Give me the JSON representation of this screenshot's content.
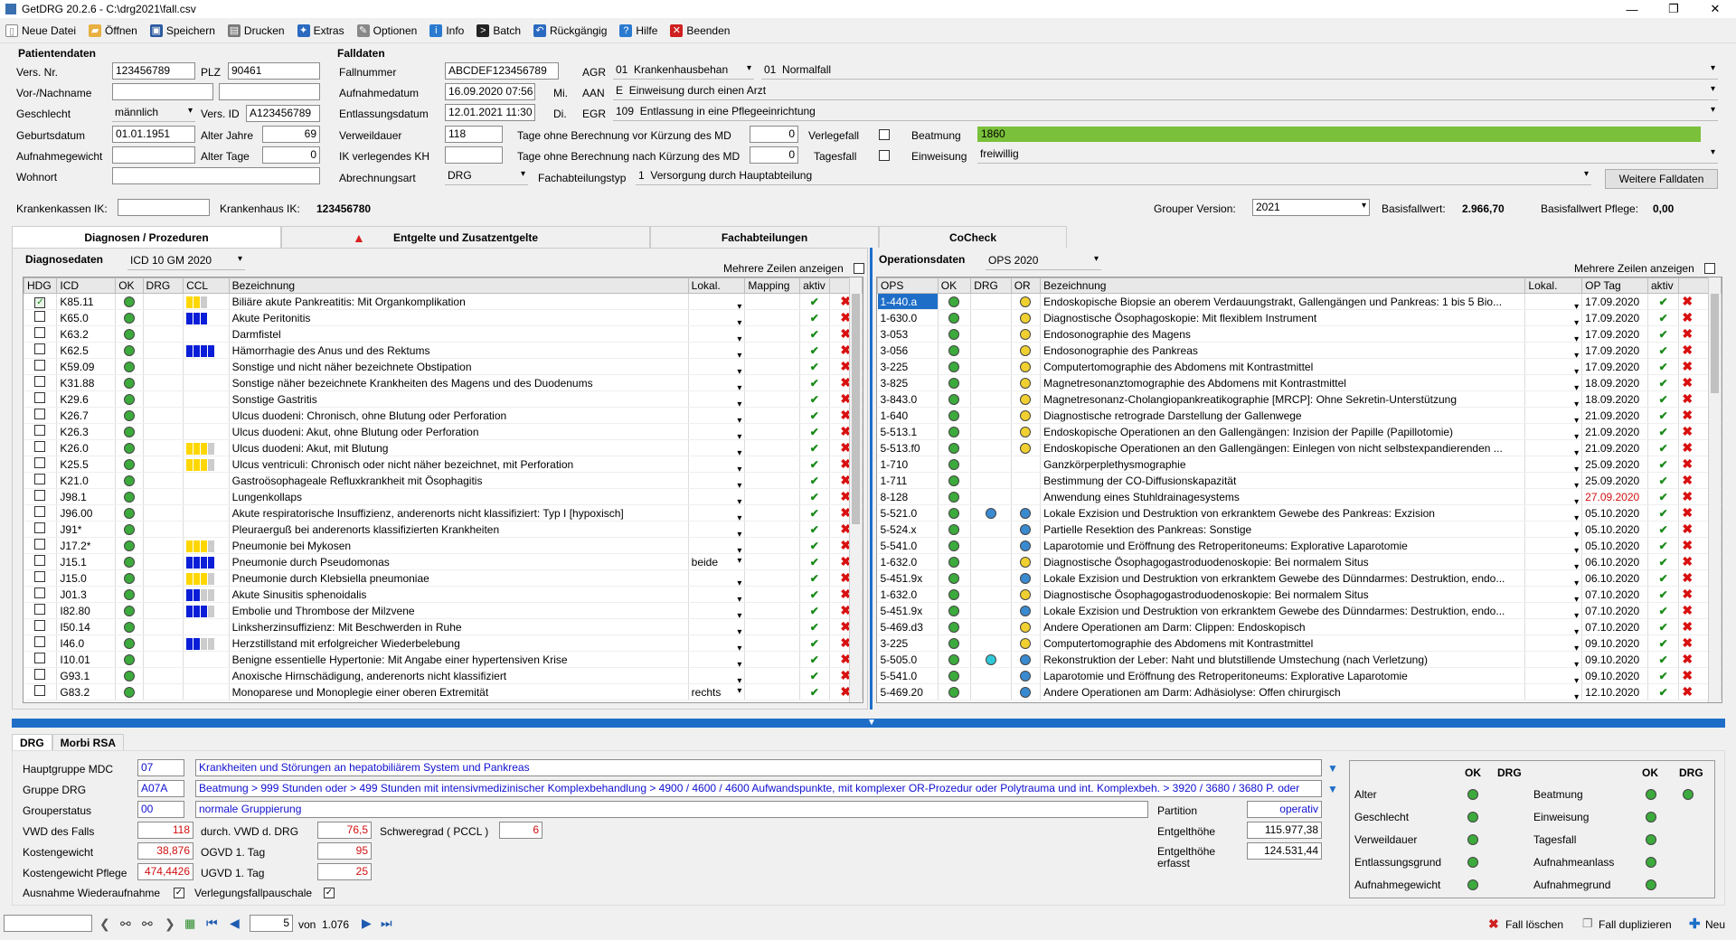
{
  "window": {
    "title": "GetDRG 20.2.6 - C:\\drg2021\\fall.csv"
  },
  "toolbar": [
    {
      "label": "Neue Datei",
      "icon": "new-file-icon",
      "color": "#ffffff"
    },
    {
      "label": "Öffnen",
      "icon": "folder-icon",
      "color": "#e8b040"
    },
    {
      "label": "Speichern",
      "icon": "save-icon",
      "color": "#2a5aa0"
    },
    {
      "label": "Drucken",
      "icon": "print-icon",
      "color": "#777777"
    },
    {
      "label": "Extras",
      "icon": "extras-icon",
      "color": "#2a6ac0"
    },
    {
      "label": "Optionen",
      "icon": "options-icon",
      "color": "#888888"
    },
    {
      "label": "Info",
      "icon": "info-icon",
      "color": "#2a7ad0"
    },
    {
      "label": "Batch",
      "icon": "batch-icon",
      "color": "#222222"
    },
    {
      "label": "Rückgängig",
      "icon": "undo-icon",
      "color": "#2a6ac0"
    },
    {
      "label": "Hilfe",
      "icon": "help-icon",
      "color": "#2a7ad0"
    },
    {
      "label": "Beenden",
      "icon": "exit-icon",
      "color": "#d02020"
    }
  ],
  "patient": {
    "title": "Patientendaten",
    "vers_nr_label": "Vers. Nr.",
    "vers_nr": "123456789",
    "plz_label": "PLZ",
    "plz": "90461",
    "name_label": "Vor-/Nachname",
    "vorname": "",
    "nachname": "",
    "geschlecht_label": "Geschlecht",
    "geschlecht": "männlich",
    "vers_id_label": "Vers. ID",
    "vers_id": "A123456789",
    "geburt_label": "Geburtsdatum",
    "geburt": "01.01.1951",
    "alter_jahre_label": "Alter Jahre",
    "alter_jahre": "69",
    "aufn_gew_label": "Aufnahmegewicht",
    "aufn_gew": "",
    "alter_tage_label": "Alter Tage",
    "alter_tage": "0",
    "wohnort_label": "Wohnort",
    "wohnort": ""
  },
  "fall": {
    "title": "Falldaten",
    "fallnummer_label": "Fallnummer",
    "fallnummer": "ABCDEF123456789",
    "agr_label": "AGR",
    "agr_code": "01",
    "agr_text": "Krankenhausbehan",
    "agr2_code": "01",
    "agr2_text": "Normalfall",
    "aufnahme_label": "Aufnahmedatum",
    "aufnahme": "16.09.2020 07:56",
    "aufnahme_day": "Mi.",
    "aan_label": "AAN",
    "aan_code": "E",
    "aan_text": "Einweisung durch einen Arzt",
    "entlassung_label": "Entlassungsdatum",
    "entlassung": "12.01.2021 11:30",
    "entlassung_day": "Di.",
    "egr_label": "EGR",
    "egr_code": "109",
    "egr_text": "Entlassung in eine Pflegeeinrichtung",
    "verweildauer_label": "Verweildauer",
    "verweildauer": "118",
    "tage_vor_label": "Tage ohne Berechnung vor Kürzung des MD",
    "tage_vor": "0",
    "verlegefall_label": "Verlegefall",
    "beatmung_label": "Beatmung",
    "beatmung": "1860",
    "ik_label": "IK verlegendes KH",
    "ik": "",
    "tage_nach_label": "Tage ohne Berechnung nach Kürzung des MD",
    "tage_nach": "0",
    "tagesfall_label": "Tagesfall",
    "einweisung_label": "Einweisung",
    "einweisung": "freiwillig",
    "abrechnung_label": "Abrechnungsart",
    "abrechnung": "DRG",
    "fachabt_label": "Fachabteilungstyp",
    "fachabt_code": "1",
    "fachabt_text": "Versorgung durch Hauptabteilung",
    "weitere_button": "Weitere Falldaten"
  },
  "ik_row": {
    "kk_label": "Krankenkassen IK:",
    "kk": "",
    "kh_label": "Krankenhaus IK:",
    "kh": "123456780",
    "grouper_label": "Grouper Version:",
    "grouper": "2021",
    "basis_label": "Basisfallwert:",
    "basis": "2.966,70",
    "basis_pflege_label": "Basisfallwert Pflege:",
    "basis_pflege": "0,00"
  },
  "tabs": [
    "Diagnosen / Prozeduren",
    "Entgelte und Zusatzentgelte",
    "Fachabteilungen",
    "CoCheck"
  ],
  "diag": {
    "title": "Diagnosedaten",
    "catalog": "ICD 10 GM 2020",
    "mehrere": "Mehrere Zeilen anzeigen",
    "headers": [
      "HDG",
      "ICD",
      "OK",
      "DRG",
      "CCL",
      "Bezeichnung",
      "Lokal.",
      "Mapping",
      "aktiv",
      ""
    ],
    "rows": [
      {
        "hdg": true,
        "icd": "K85.11",
        "ccl": "yyg",
        "text": "Biliäre akute Pankreatitis: Mit Organkomplikation",
        "lokal": ""
      },
      {
        "hdg": false,
        "icd": "K65.0",
        "ccl": "bbb",
        "text": "Akute Peritonitis",
        "lokal": ""
      },
      {
        "hdg": false,
        "icd": "K63.2",
        "ccl": "",
        "text": "Darmfistel",
        "lokal": ""
      },
      {
        "hdg": false,
        "icd": "K62.5",
        "ccl": "bbbb",
        "text": "Hämorrhagie des Anus und des Rektums",
        "lokal": ""
      },
      {
        "hdg": false,
        "icd": "K59.09",
        "ccl": "",
        "text": "Sonstige und nicht näher bezeichnete Obstipation",
        "lokal": ""
      },
      {
        "hdg": false,
        "icd": "K31.88",
        "ccl": "",
        "text": "Sonstige näher bezeichnete Krankheiten des Magens und des Duodenums",
        "lokal": ""
      },
      {
        "hdg": false,
        "icd": "K29.6",
        "ccl": "",
        "text": "Sonstige Gastritis",
        "lokal": ""
      },
      {
        "hdg": false,
        "icd": "K26.7",
        "ccl": "",
        "text": "Ulcus duodeni: Chronisch, ohne Blutung oder Perforation",
        "lokal": ""
      },
      {
        "hdg": false,
        "icd": "K26.3",
        "ccl": "",
        "text": "Ulcus duodeni: Akut, ohne Blutung oder Perforation",
        "lokal": ""
      },
      {
        "hdg": false,
        "icd": "K26.0",
        "ccl": "yyyg",
        "text": "Ulcus duodeni: Akut, mit Blutung",
        "lokal": ""
      },
      {
        "hdg": false,
        "icd": "K25.5",
        "ccl": "yyyg",
        "text": "Ulcus ventriculi: Chronisch oder nicht näher bezeichnet, mit Perforation",
        "lokal": ""
      },
      {
        "hdg": false,
        "icd": "K21.0",
        "ccl": "",
        "text": "Gastroösophageale Refluxkrankheit mit Ösophagitis",
        "lokal": ""
      },
      {
        "hdg": false,
        "icd": "J98.1",
        "ccl": "",
        "text": "Lungenkollaps",
        "lokal": ""
      },
      {
        "hdg": false,
        "icd": "J96.00",
        "ccl": "",
        "text": "Akute respiratorische Insuffizienz, anderenorts nicht klassifiziert: Typ I [hypoxisch]",
        "lokal": ""
      },
      {
        "hdg": false,
        "icd": "J91*",
        "ccl": "",
        "text": "Pleuraerguß bei anderenorts klassifizierten Krankheiten",
        "lokal": ""
      },
      {
        "hdg": false,
        "icd": "J17.2*",
        "ccl": "yyyg",
        "text": "Pneumonie bei Mykosen",
        "lokal": ""
      },
      {
        "hdg": false,
        "icd": "J15.1",
        "ccl": "bbbb",
        "text": "Pneumonie durch Pseudomonas",
        "lokal": "beide"
      },
      {
        "hdg": false,
        "icd": "J15.0",
        "ccl": "yyyg",
        "text": "Pneumonie durch Klebsiella pneumoniae",
        "lokal": ""
      },
      {
        "hdg": false,
        "icd": "J01.3",
        "ccl": "bbgg",
        "text": "Akute Sinusitis sphenoidalis",
        "lokal": ""
      },
      {
        "hdg": false,
        "icd": "I82.80",
        "ccl": "bbbg",
        "text": "Embolie und Thrombose der Milzvene",
        "lokal": ""
      },
      {
        "hdg": false,
        "icd": "I50.14",
        "ccl": "",
        "text": "Linksherzinsuffizienz: Mit Beschwerden in Ruhe",
        "lokal": ""
      },
      {
        "hdg": false,
        "icd": "I46.0",
        "ccl": "bbgg",
        "text": "Herzstillstand mit erfolgreicher Wiederbelebung",
        "lokal": ""
      },
      {
        "hdg": false,
        "icd": "I10.01",
        "ccl": "",
        "text": "Benigne essentielle Hypertonie: Mit Angabe einer hypertensiven Krise",
        "lokal": ""
      },
      {
        "hdg": false,
        "icd": "G93.1",
        "ccl": "",
        "text": "Anoxische Hirnschädigung, anderenorts nicht klassifiziert",
        "lokal": ""
      },
      {
        "hdg": false,
        "icd": "G83.2",
        "ccl": "",
        "text": "Monoparese und Monoplegie einer oberen Extremität",
        "lokal": "rechts"
      }
    ]
  },
  "ops": {
    "title": "Operationsdaten",
    "catalog": "OPS 2020",
    "mehrere": "Mehrere Zeilen anzeigen",
    "headers": [
      "OPS",
      "OK",
      "DRG",
      "OR",
      "Bezeichnung",
      "Lokal.",
      "OP Tag",
      "aktiv",
      ""
    ],
    "rows": [
      {
        "ops": "1-440.a",
        "drg": "",
        "or": "y",
        "text": "Endoskopische Biopsie an oberem Verdauungstrakt, Gallengängen und Pankreas: 1 bis 5 Bio...",
        "date": "17.09.2020",
        "sel": true
      },
      {
        "ops": "1-630.0",
        "drg": "",
        "or": "y",
        "text": "Diagnostische Ösophagoskopie: Mit flexiblem Instrument",
        "date": "17.09.2020"
      },
      {
        "ops": "3-053",
        "drg": "",
        "or": "y",
        "text": "Endosonographie des Magens",
        "date": "17.09.2020"
      },
      {
        "ops": "3-056",
        "drg": "",
        "or": "y",
        "text": "Endosonographie des Pankreas",
        "date": "17.09.2020"
      },
      {
        "ops": "3-225",
        "drg": "",
        "or": "y",
        "text": "Computertomographie des Abdomens mit Kontrastmittel",
        "date": "17.09.2020"
      },
      {
        "ops": "3-825",
        "drg": "",
        "or": "y",
        "text": "Magnetresonanztomographie des Abdomens mit Kontrastmittel",
        "date": "18.09.2020"
      },
      {
        "ops": "3-843.0",
        "drg": "",
        "or": "y",
        "text": "Magnetresonanz-Cholangiopankreatikographie [MRCP]: Ohne Sekretin-Unterstützung",
        "date": "18.09.2020"
      },
      {
        "ops": "1-640",
        "drg": "",
        "or": "y",
        "text": "Diagnostische retrograde Darstellung der Gallenwege",
        "date": "21.09.2020"
      },
      {
        "ops": "5-513.1",
        "drg": "",
        "or": "y",
        "text": "Endoskopische Operationen an den Gallengängen: Inzision der Papille (Papillotomie)",
        "date": "21.09.2020"
      },
      {
        "ops": "5-513.f0",
        "drg": "",
        "or": "y",
        "text": "Endoskopische Operationen an den Gallengängen: Einlegen von nicht selbstexpandierenden ...",
        "date": "21.09.2020"
      },
      {
        "ops": "1-710",
        "drg": "",
        "or": "",
        "text": "Ganzkörperplethysmographie",
        "date": "25.09.2020"
      },
      {
        "ops": "1-711",
        "drg": "",
        "or": "",
        "text": "Bestimmung der CO-Diffusionskapazität",
        "date": "25.09.2020"
      },
      {
        "ops": "8-128",
        "drg": "",
        "or": "",
        "text": "Anwendung eines Stuhldrainagesystems",
        "date": "27.09.2020",
        "datered": true
      },
      {
        "ops": "5-521.0",
        "drg": "b",
        "or": "b",
        "text": "Lokale Exzision und Destruktion von erkranktem Gewebe des Pankreas: Exzision",
        "date": "05.10.2020"
      },
      {
        "ops": "5-524.x",
        "drg": "",
        "or": "b",
        "text": "Partielle Resektion des Pankreas: Sonstige",
        "date": "05.10.2020"
      },
      {
        "ops": "5-541.0",
        "drg": "",
        "or": "b",
        "text": "Laparotomie und Eröffnung des Retroperitoneums: Explorative Laparotomie",
        "date": "05.10.2020"
      },
      {
        "ops": "1-632.0",
        "drg": "",
        "or": "y",
        "text": "Diagnostische Ösophagogastroduodenoskopie: Bei normalem Situs",
        "date": "06.10.2020"
      },
      {
        "ops": "5-451.9x",
        "drg": "",
        "or": "b",
        "text": "Lokale Exzision und Destruktion von erkranktem Gewebe des Dünndarmes: Destruktion, endo...",
        "date": "06.10.2020"
      },
      {
        "ops": "1-632.0",
        "drg": "",
        "or": "y",
        "text": "Diagnostische Ösophagogastroduodenoskopie: Bei normalem Situs",
        "date": "07.10.2020"
      },
      {
        "ops": "5-451.9x",
        "drg": "",
        "or": "b",
        "text": "Lokale Exzision und Destruktion von erkranktem Gewebe des Dünndarmes: Destruktion, endo...",
        "date": "07.10.2020"
      },
      {
        "ops": "5-469.d3",
        "drg": "",
        "or": "y",
        "text": "Andere Operationen am Darm: Clippen: Endoskopisch",
        "date": "07.10.2020"
      },
      {
        "ops": "3-225",
        "drg": "",
        "or": "y",
        "text": "Computertomographie des Abdomens mit Kontrastmittel",
        "date": "09.10.2020"
      },
      {
        "ops": "5-505.0",
        "drg": "c",
        "or": "b",
        "text": "Rekonstruktion der Leber: Naht und blutstillende Umstechung (nach Verletzung)",
        "date": "09.10.2020"
      },
      {
        "ops": "5-541.0",
        "drg": "",
        "or": "b",
        "text": "Laparotomie und Eröffnung des Retroperitoneums: Explorative Laparotomie",
        "date": "09.10.2020"
      },
      {
        "ops": "5-469.20",
        "drg": "",
        "or": "b",
        "text": "Andere Operationen am Darm: Adhäsiolyse: Offen chirurgisch",
        "date": "12.10.2020"
      }
    ]
  },
  "drg_tabs": [
    "DRG",
    "Morbi RSA"
  ],
  "drg": {
    "mdc_label": "Hauptgruppe MDC",
    "mdc_code": "07",
    "mdc_text": "Krankheiten und Störungen an hepatobiliärem System und Pankreas",
    "gruppe_label": "Gruppe DRG",
    "gruppe_code": "A07A",
    "gruppe_text": "Beatmung > 999 Stunden oder > 499 Stunden mit intensivmedizinischer Komplexbehandlung > 4900 / 4600 / 4600 Aufwandspunkte, mit komplexer OR-Prozedur oder Polytrauma und int. Komplexbeh. > 3920 / 3680 / 3680 P. oder",
    "status_label": "Grouperstatus",
    "status_code": "00",
    "status_text": "normale Gruppierung",
    "vwd_label": "VWD des Falls",
    "vwd": "118",
    "durch_label": "durch. VWD d. DRG",
    "durch": "76,5",
    "schwere_label": "Schweregrad ( PCCL )",
    "schwere": "6",
    "kosten_label": "Kostengewicht",
    "kosten": "38,876",
    "ogvd_label": "OGVD 1. Tag",
    "ogvd": "95",
    "kostenpfl_label": "Kostengewicht Pflege",
    "kostenpfl": "474,4426",
    "ugvd_label": "UGVD 1. Tag",
    "ugvd": "25",
    "ausnahme_label": "Ausnahme Wiederaufnahme",
    "verlegung_label": "Verlegungsfallpauschale",
    "partition_label": "Partition",
    "partition": "operativ",
    "entgelt_label": "Entgelthöhe",
    "entgelt": "115.977,38",
    "entgelt_erf_label": "Entgelthöhe erfasst",
    "entgelt_erf": "124.531,44"
  },
  "checks": {
    "ok_header": "OK",
    "drg_header": "DRG",
    "left": [
      "Alter",
      "Geschlecht",
      "Verweildauer",
      "Entlassungsgrund",
      "Aufnahmegewicht"
    ],
    "right": [
      "Beatmung",
      "Einweisung",
      "Tagesfall",
      "Aufnahmeanlass",
      "Aufnahmegrund"
    ]
  },
  "status": {
    "page": "5",
    "von": "von",
    "total": "1.076",
    "delete": "Fall löschen",
    "dup": "Fall duplizieren",
    "new": "Neu"
  }
}
